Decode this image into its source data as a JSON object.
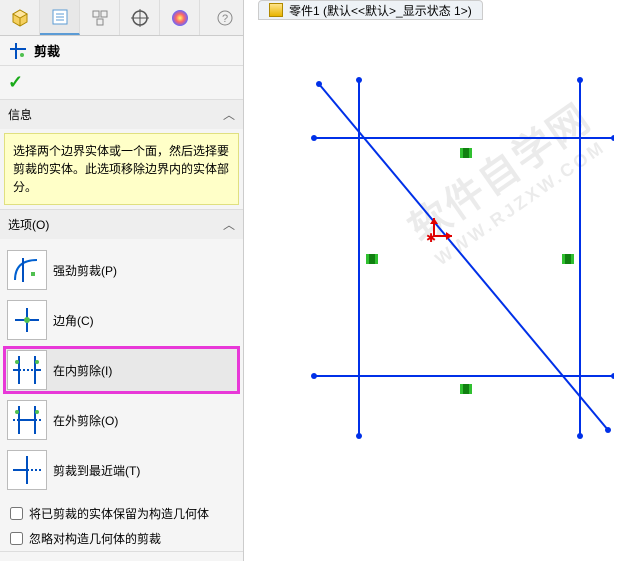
{
  "panel": {
    "title": "剪裁",
    "info_header": "信息",
    "info_text": "选择两个边界实体或一个面，然后选择要剪裁的实体。此选项移除边界内的实体部分。",
    "options_header": "选项(O)",
    "options": [
      {
        "label": "强劲剪裁(P)"
      },
      {
        "label": "边角(C)"
      },
      {
        "label": "在内剪除(I)"
      },
      {
        "label": "在外剪除(O)"
      },
      {
        "label": "剪裁到最近端(T)"
      }
    ],
    "checkboxes": [
      {
        "label": "将已剪裁的实体保留为构造几何体"
      },
      {
        "label": "忽略对构造几何体的剪裁"
      }
    ]
  },
  "doc": {
    "tab_label": "零件1 (默认<<默认>_显示状态 1>)"
  },
  "watermark": {
    "line1": "软件自学网",
    "line2": "WWW.RJZXW.COM"
  }
}
